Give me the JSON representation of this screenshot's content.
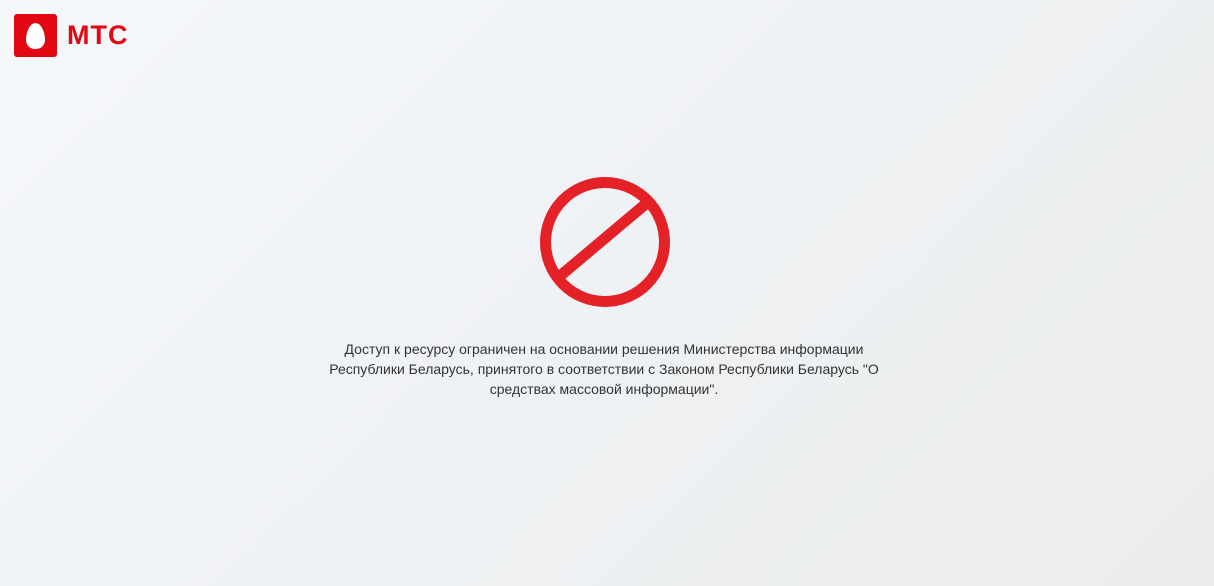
{
  "brand": {
    "logo_text": "МТС",
    "accent_color": "#e30613"
  },
  "icon": {
    "name": "prohibited-icon",
    "color": "#e52128"
  },
  "notice": {
    "text": "Доступ к ресурсу ограничен на основании решения Министерства информации Республики Беларусь, принятого в соответствии с Законом Республики Беларусь \"О средствах массовой информации\"."
  }
}
